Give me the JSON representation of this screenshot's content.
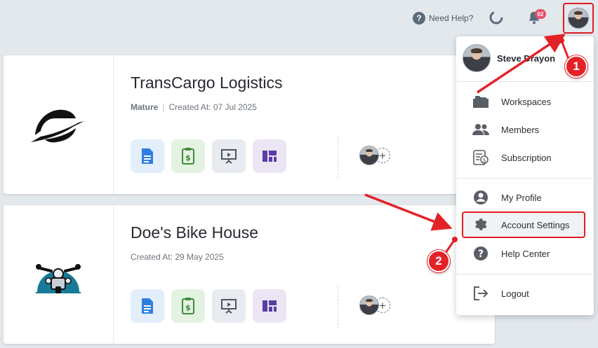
{
  "header": {
    "help_label": "Need Help?",
    "notification_count": "02",
    "icons": [
      "help-icon",
      "sync-icon",
      "bell-icon",
      "avatar"
    ]
  },
  "workspaces": [
    {
      "name": "TransCargo Logistics",
      "stage": "Mature",
      "created": "Created At: 07 Jul 2025",
      "tools": [
        "document-icon",
        "invoice-icon",
        "presentation-icon",
        "board-icon"
      ]
    },
    {
      "name": "Doe's Bike House",
      "created": "Created At: 29 May 2025",
      "tools": [
        "document-icon",
        "invoice-icon",
        "presentation-icon",
        "board-icon"
      ]
    }
  ],
  "menu": {
    "user_name": "Steve Drayon",
    "items": [
      {
        "label": "Workspaces",
        "icon": "folder-icon"
      },
      {
        "label": "Members",
        "icon": "people-icon"
      },
      {
        "label": "Subscription",
        "icon": "receipt-icon"
      },
      {
        "label": "My Profile",
        "icon": "person-icon"
      },
      {
        "label": "Account Settings",
        "icon": "gear-icon"
      },
      {
        "label": "Help Center",
        "icon": "help-icon"
      },
      {
        "label": "Logout",
        "icon": "logout-icon"
      }
    ]
  },
  "annotations": {
    "step1": "1",
    "step2": "2",
    "color": "#e32228"
  },
  "colors": {
    "highlight_border": "#e01d23",
    "badge": "#e5506b",
    "page_bg": "#e3e8ed"
  }
}
